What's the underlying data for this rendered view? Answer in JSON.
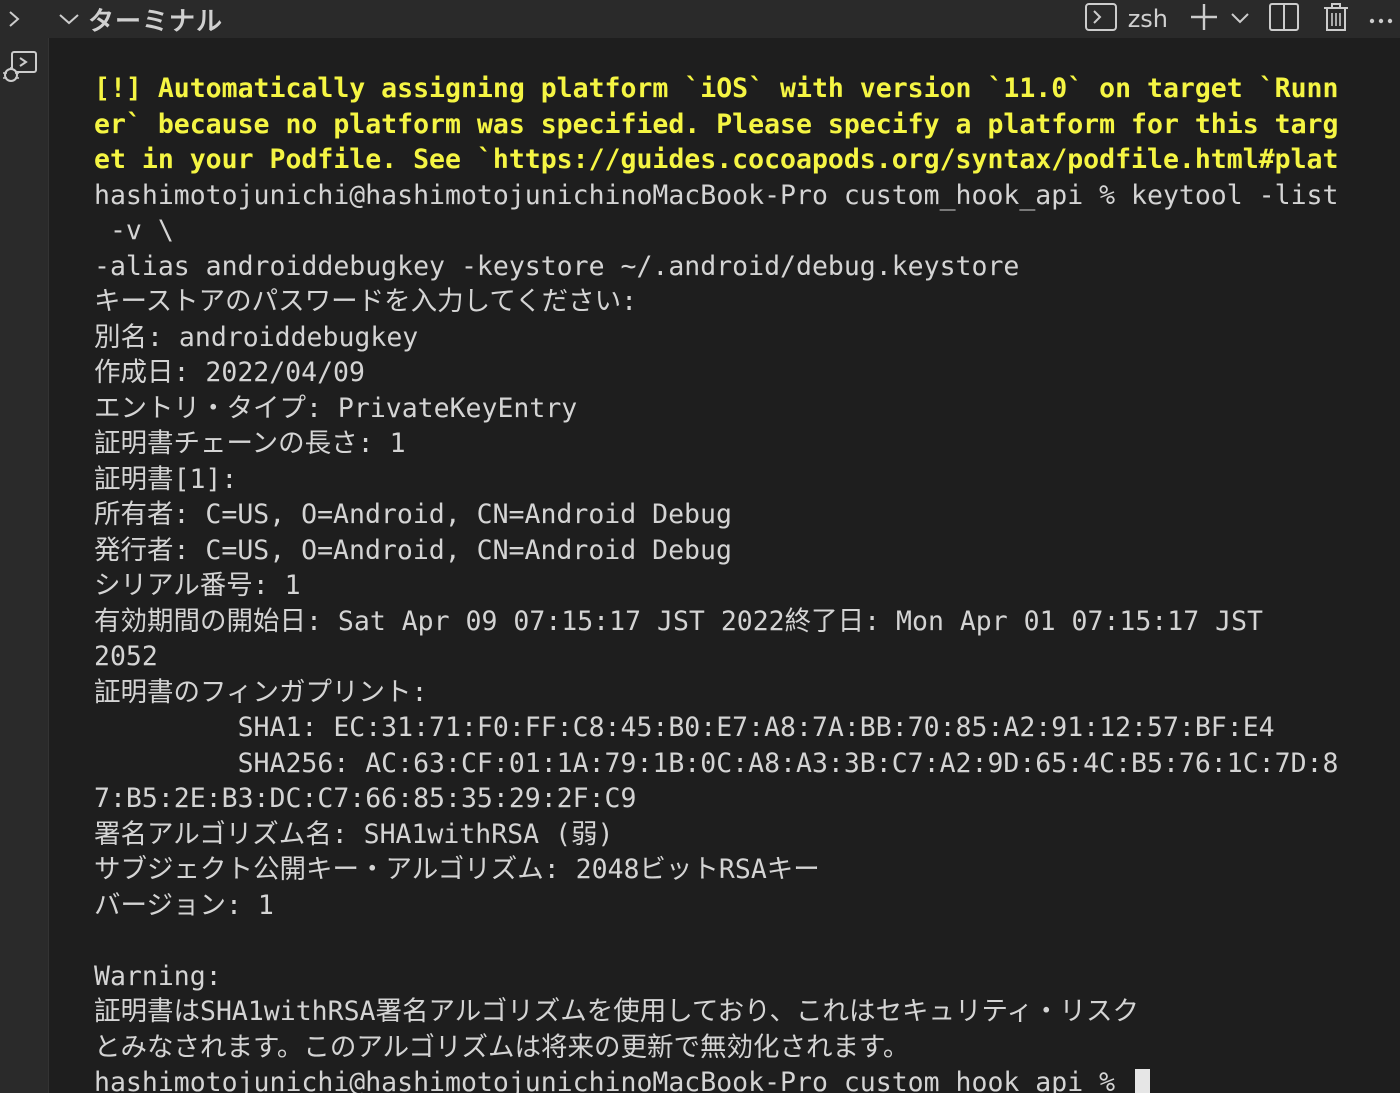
{
  "header": {
    "panel_title": "ターミナル",
    "shell_name": "zsh"
  },
  "terminal": {
    "lines": [
      {
        "text": "[!] Automatically assigning platform `iOS` with version `11.0` on target `Runn",
        "style": "warn"
      },
      {
        "text": "er` because no platform was specified. Please specify a platform for this targ",
        "style": "warn"
      },
      {
        "text": "et in your Podfile. See `https://guides.cocoapods.org/syntax/podfile.html#plat",
        "style": "warn"
      },
      {
        "text": "hashimotojunichi@hashimotojunichinoMacBook-Pro custom_hook_api % keytool -list",
        "style": "normal"
      },
      {
        "text": " -v \\",
        "style": "normal"
      },
      {
        "text": "-alias androiddebugkey -keystore ~/.android/debug.keystore",
        "style": "normal"
      },
      {
        "text": "キーストアのパスワードを入力してください:",
        "style": "normal"
      },
      {
        "text": "別名: androiddebugkey",
        "style": "normal"
      },
      {
        "text": "作成日: 2022/04/09",
        "style": "normal"
      },
      {
        "text": "エントリ・タイプ: PrivateKeyEntry",
        "style": "normal"
      },
      {
        "text": "証明書チェーンの長さ: 1",
        "style": "normal"
      },
      {
        "text": "証明書[1]:",
        "style": "normal"
      },
      {
        "text": "所有者: C=US, O=Android, CN=Android Debug",
        "style": "normal"
      },
      {
        "text": "発行者: C=US, O=Android, CN=Android Debug",
        "style": "normal"
      },
      {
        "text": "シリアル番号: 1",
        "style": "normal"
      },
      {
        "text": "有効期間の開始日: Sat Apr 09 07:15:17 JST 2022終了日: Mon Apr 01 07:15:17 JST",
        "style": "normal"
      },
      {
        "text": "2052",
        "style": "normal"
      },
      {
        "text": "証明書のフィンガプリント:",
        "style": "normal"
      },
      {
        "text": "         SHA1: EC:31:71:F0:FF:C8:45:B0:E7:A8:7A:BB:70:85:A2:91:12:57:BF:E4",
        "style": "normal"
      },
      {
        "text": "         SHA256: AC:63:CF:01:1A:79:1B:0C:A8:A3:3B:C7:A2:9D:65:4C:B5:76:1C:7D:8",
        "style": "normal"
      },
      {
        "text": "7:B5:2E:B3:DC:C7:66:85:35:29:2F:C9",
        "style": "normal"
      },
      {
        "text": "署名アルゴリズム名: SHA1withRSA (弱)",
        "style": "normal"
      },
      {
        "text": "サブジェクト公開キー・アルゴリズム: 2048ビットRSAキー",
        "style": "normal"
      },
      {
        "text": "バージョン: 1",
        "style": "normal"
      },
      {
        "text": "",
        "style": "normal"
      },
      {
        "text": "Warning:",
        "style": "normal"
      },
      {
        "text": "証明書はSHA1withRSA署名アルゴリズムを使用しており、これはセキュリティ・リスク",
        "style": "normal"
      },
      {
        "text": "とみなされます。このアルゴリズムは将来の更新で無効化されます。",
        "style": "normal"
      }
    ],
    "prompt": "hashimotojunichi@hashimotojunichinoMacBook-Pro custom_hook_api % "
  },
  "colors": {
    "warning_text": "#f5f543",
    "normal_text": "#d4d4d4",
    "background": "#1e1e1e",
    "header_bg": "#2a2a2a"
  },
  "icons": {
    "collapse": "chevron-right-icon",
    "expand": "chevron-down-icon",
    "terminal": "terminal-icon",
    "new_terminal": "plus-icon",
    "dropdown": "chevron-down-icon",
    "split": "split-icon",
    "trash": "trash-icon",
    "more": "ellipsis-icon",
    "debug": "debug-icon"
  }
}
